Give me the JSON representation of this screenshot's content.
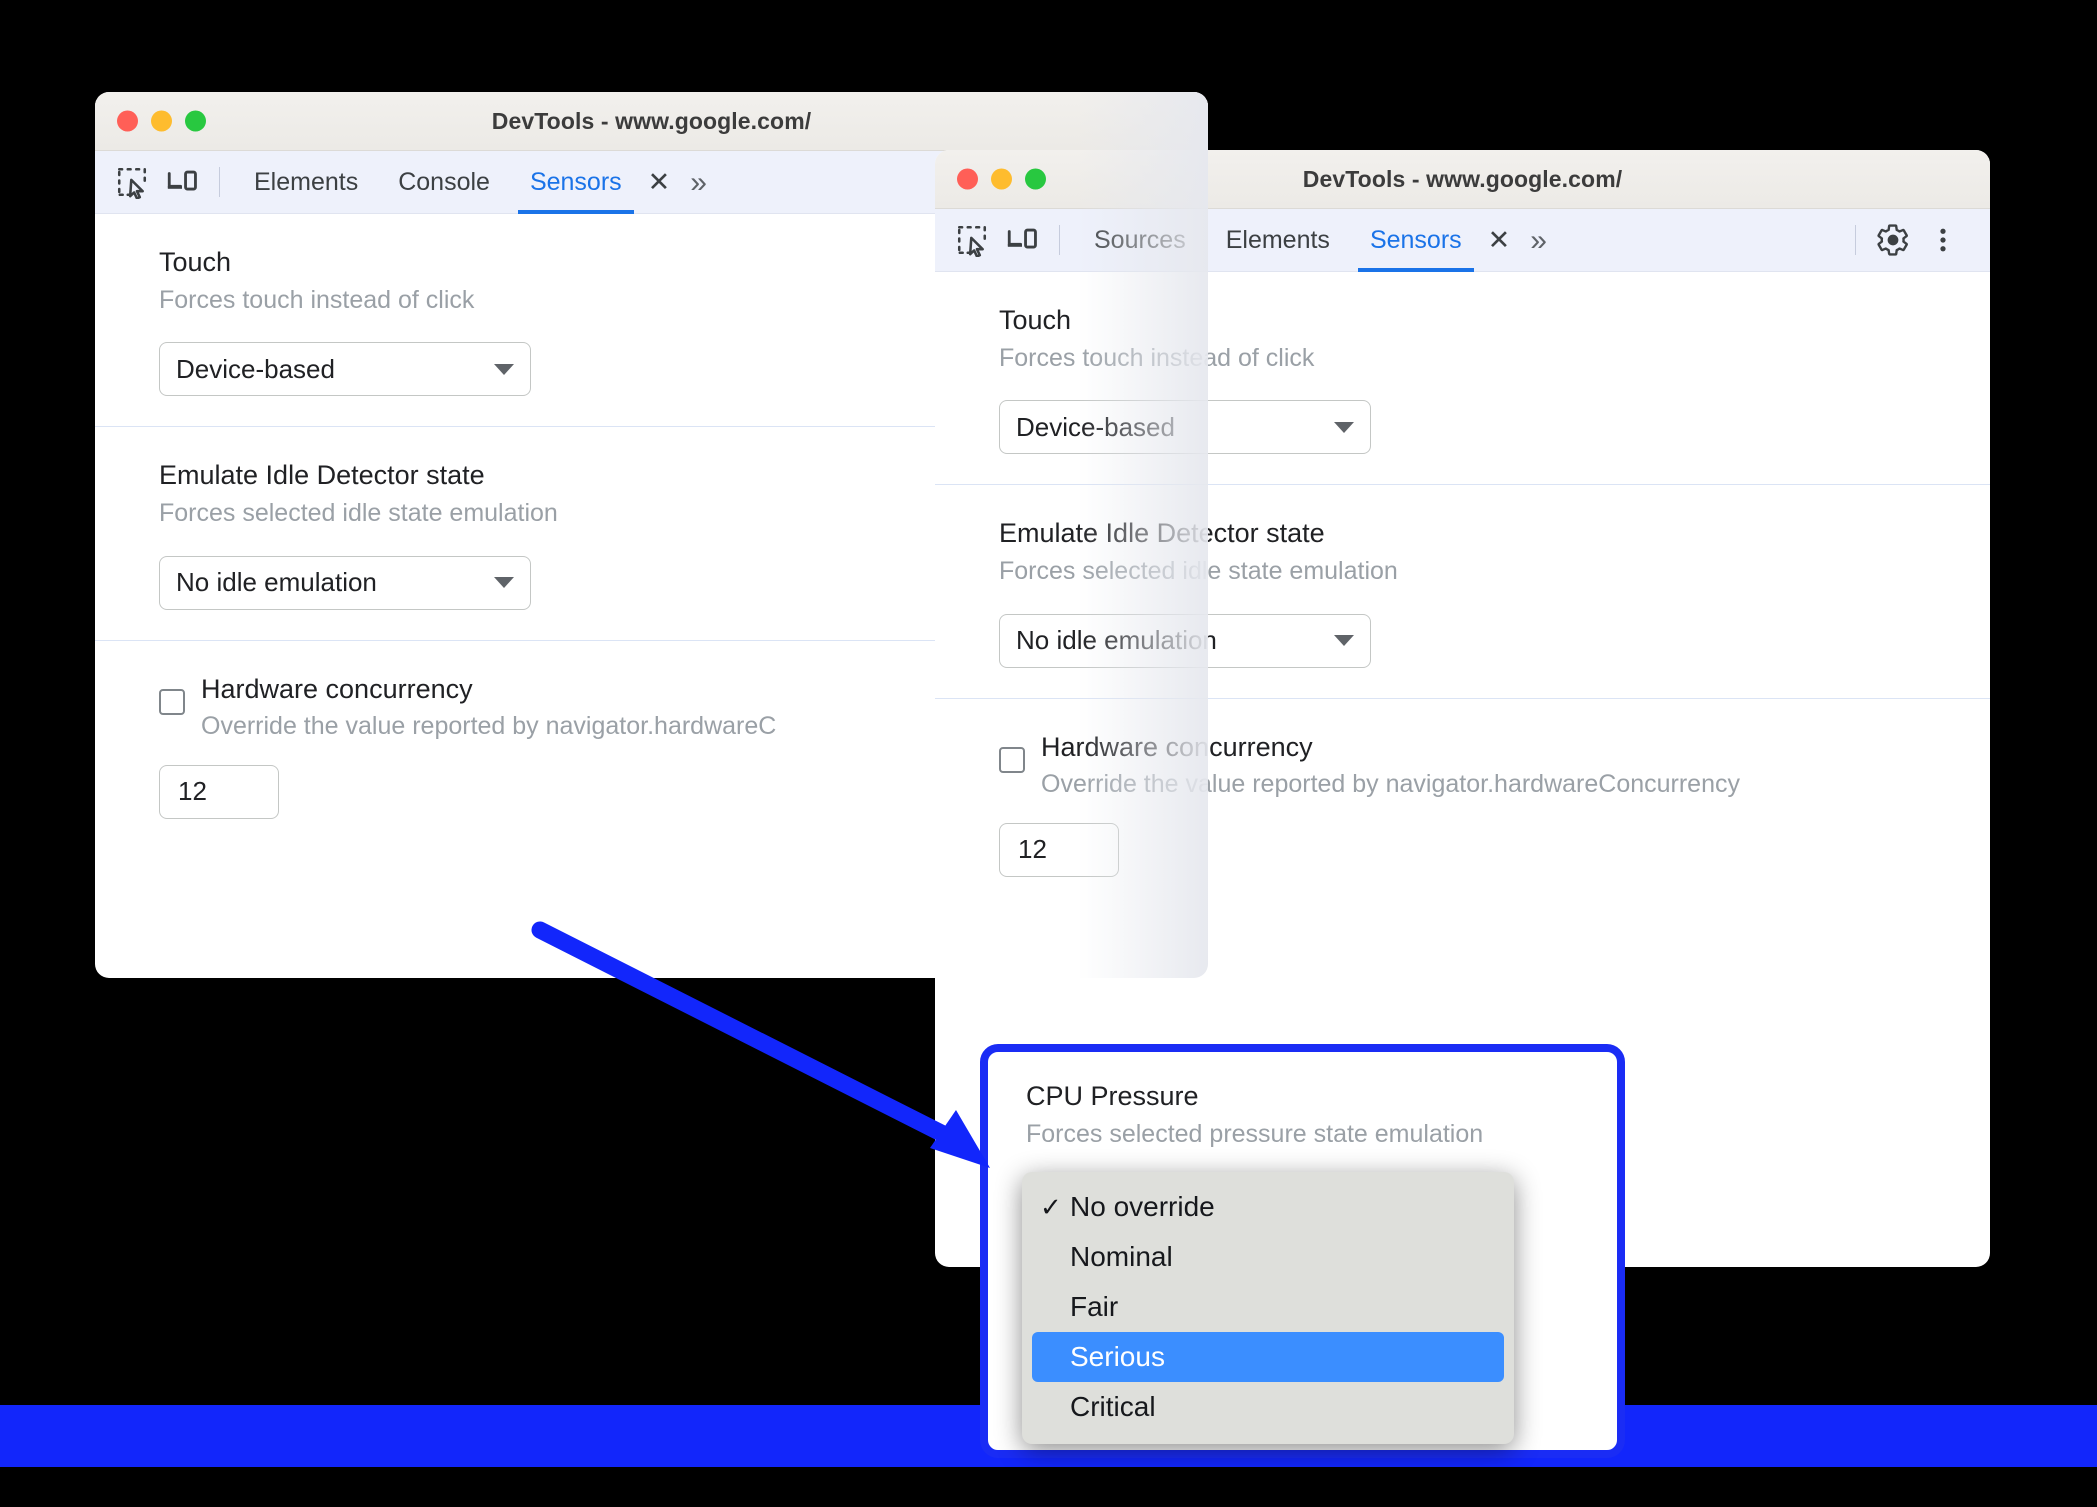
{
  "colors": {
    "accent_blue": "#1a73e8",
    "highlight_border": "#1a2cf5",
    "arrow": "#1226fb",
    "band": "#1226fb",
    "menu_selected": "#3b8eff",
    "traffic_red": "#ff5f57",
    "traffic_yellow": "#febc2e",
    "traffic_green": "#28c840"
  },
  "window_one": {
    "title": "DevTools - www.google.com/",
    "traffic_lights": [
      "close-red",
      "minimize-yellow",
      "maximize-green"
    ],
    "toolbar": {
      "inspect_icon": "inspect-element-icon",
      "device_icon": "device-toolbar-icon",
      "tabs": [
        {
          "label": "Elements",
          "active": false
        },
        {
          "label": "Console",
          "active": false
        },
        {
          "label": "Sensors",
          "active": true
        }
      ],
      "close_tab_label": "✕",
      "more_tabs_label": "»"
    },
    "sections": [
      {
        "key": "touch",
        "title": "Touch",
        "subtitle": "Forces touch instead of click",
        "control": "select",
        "value": "Device-based"
      },
      {
        "key": "idle",
        "title": "Emulate Idle Detector state",
        "subtitle": "Forces selected idle state emulation",
        "control": "select",
        "value": "No idle emulation"
      },
      {
        "key": "hardware_concurrency",
        "title": "Hardware concurrency",
        "subtitle": "Override the value reported by navigator.hardwareC",
        "control": "checkbox-number",
        "checked": false,
        "value": "12"
      }
    ]
  },
  "window_two": {
    "title": "DevTools - www.google.com/",
    "traffic_lights": [
      "close-red",
      "minimize-yellow",
      "maximize-green"
    ],
    "toolbar": {
      "inspect_icon": "inspect-element-icon",
      "device_icon": "device-toolbar-icon",
      "tabs": [
        {
          "label": "Sources",
          "active": false
        },
        {
          "label": "Elements",
          "active": false
        },
        {
          "label": "Sensors",
          "active": true
        }
      ],
      "close_tab_label": "✕",
      "more_tabs_label": "»",
      "settings_icon": "gear-icon",
      "more_options_icon": "kebab-menu-icon"
    },
    "sections": [
      {
        "key": "touch",
        "title": "Touch",
        "subtitle": "Forces touch instead of click",
        "control": "select",
        "value": "Device-based"
      },
      {
        "key": "idle",
        "title": "Emulate Idle Detector state",
        "subtitle": "Forces selected idle state emulation",
        "control": "select",
        "value": "No idle emulation"
      },
      {
        "key": "hardware_concurrency",
        "title": "Hardware concurrency",
        "subtitle": "Override the value reported by navigator.hardwareConcurrency",
        "control": "checkbox-number",
        "checked": false,
        "value": "12"
      }
    ]
  },
  "cpu_pressure": {
    "title": "CPU Pressure",
    "subtitle": "Forces selected pressure state emulation",
    "highlighted": true,
    "dropdown_open": true,
    "selected_value": "No override",
    "hovered_value": "Serious",
    "options": [
      {
        "label": "No override",
        "checked": true,
        "highlighted": false
      },
      {
        "label": "Nominal",
        "checked": false,
        "highlighted": false
      },
      {
        "label": "Fair",
        "checked": false,
        "highlighted": false
      },
      {
        "label": "Serious",
        "checked": false,
        "highlighted": true
      },
      {
        "label": "Critical",
        "checked": false,
        "highlighted": false
      }
    ],
    "check_glyph": "✓"
  },
  "annotation": {
    "arrow": "blue-arrow-pointing-to-cpu-pressure"
  }
}
